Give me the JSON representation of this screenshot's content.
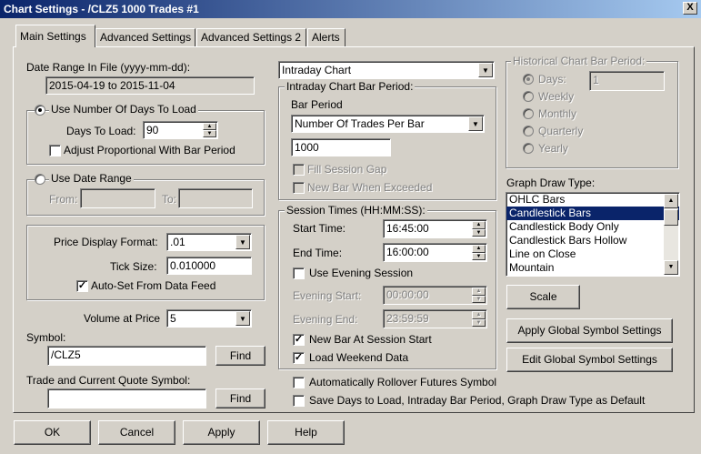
{
  "window": {
    "title": "Chart Settings - /CLZ5  1000 Trades  #1",
    "close": "X"
  },
  "tabs": [
    "Main Settings",
    "Advanced Settings",
    "Advanced Settings 2",
    "Alerts"
  ],
  "date_range": {
    "label": "Date Range In File (yyyy-mm-dd):",
    "value": "2015-04-19 to 2015-11-04"
  },
  "days_group": {
    "radio_label": "Use Number Of Days To Load",
    "days_label": "Days To Load:",
    "days_value": "90",
    "adjust_label": "Adjust Proportional With Bar Period"
  },
  "date_range_group": {
    "radio_label": "Use Date Range",
    "from_label": "From:",
    "to_label": "To:"
  },
  "price_group": {
    "format_label": "Price Display Format:",
    "format_value": ".01",
    "tick_label": "Tick Size:",
    "tick_value": "0.010000",
    "autoset_label": "Auto-Set From Data Feed"
  },
  "volume": {
    "label": "Volume at Price",
    "value": "5"
  },
  "symbol": {
    "label": "Symbol:",
    "value": "/CLZ5",
    "find": "Find"
  },
  "trade_symbol": {
    "label": "Trade and Current Quote Symbol:",
    "value": "",
    "find": "Find"
  },
  "chart_type": {
    "value": "Intraday Chart"
  },
  "intraday": {
    "legend": "Intraday Chart Bar Period:",
    "bar_period_label": "Bar Period",
    "bar_period_value": "Number Of Trades Per Bar",
    "trades_value": "1000",
    "fill_gap": "Fill Session Gap",
    "new_bar": "New Bar When Exceeded"
  },
  "session": {
    "legend": "Session Times (HH:MM:SS):",
    "start_label": "Start Time:",
    "start_value": "16:45:00",
    "end_label": "End Time:",
    "end_value": "16:00:00",
    "evening_label": "Use Evening Session",
    "evening_start_label": "Evening Start:",
    "evening_start_value": "00:00:00",
    "evening_end_label": "Evening End:",
    "evening_end_value": "23:59:59",
    "new_bar_label": "New Bar At Session Start",
    "weekend_label": "Load Weekend Data"
  },
  "rollover": {
    "label": "Automatically Rollover Futures Symbol"
  },
  "save_default": {
    "label": "Save Days to Load, Intraday Bar Period, Graph Draw Type as Default"
  },
  "historical": {
    "legend": "Historical Chart Bar Period:",
    "options": [
      "Days:",
      "Weekly",
      "Monthly",
      "Quarterly",
      "Yearly"
    ],
    "days_value": "1"
  },
  "graph_draw": {
    "label": "Graph Draw Type:",
    "items": [
      "OHLC Bars",
      "Candlestick Bars",
      "Candlestick Body Only",
      "Candlestick Bars Hollow",
      "Line on Close",
      "Mountain"
    ],
    "selected": "Candlestick Bars"
  },
  "buttons": {
    "scale": "Scale",
    "apply_global": "Apply Global Symbol Settings",
    "edit_global": "Edit Global Symbol Settings",
    "ok": "OK",
    "cancel": "Cancel",
    "apply": "Apply",
    "help": "Help"
  }
}
